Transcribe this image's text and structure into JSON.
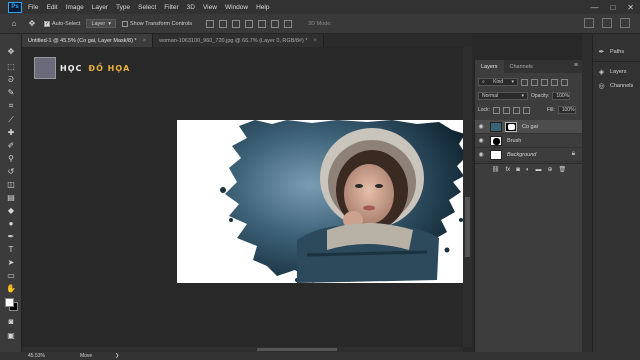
{
  "menubar": {
    "logo": "Ps",
    "items": [
      "File",
      "Edit",
      "Image",
      "Layer",
      "Type",
      "Select",
      "Filter",
      "3D",
      "View",
      "Window",
      "Help"
    ],
    "window_controls": [
      "—",
      "□",
      "✕"
    ]
  },
  "options": {
    "auto_select_label": "Auto-Select",
    "auto_select_target": "Layer",
    "transform_label": "Show Transform Controls",
    "mode_3d": "3D Mode:"
  },
  "tabs": [
    {
      "label": "Untitled-1 @ 45.5% (Co gai, Layer Mask/8) *",
      "active": true
    },
    {
      "label": "woman-1063100_960_720.jpg @ 66.7% (Layer 0, RGB/8#) *",
      "active": false
    }
  ],
  "brand": {
    "left": "HỌC",
    "right": "ĐỒ HỌA"
  },
  "layers_panel": {
    "tabs": [
      "Layers",
      "Channels"
    ],
    "kind_label": "Kind",
    "blend_mode": "Normal",
    "opacity_label": "Opacity:",
    "opacity_value": "100%",
    "lock_label": "Lock:",
    "fill_label": "Fill:",
    "fill_value": "100%",
    "layers": [
      {
        "name": "Co gai",
        "selected": true
      },
      {
        "name": "Brush",
        "selected": false
      },
      {
        "name": "Background",
        "selected": false
      }
    ]
  },
  "dock": {
    "items": [
      "Paths",
      "Layers",
      "Channels"
    ]
  },
  "status": {
    "zoom": "45.53%",
    "tool": "Move"
  }
}
